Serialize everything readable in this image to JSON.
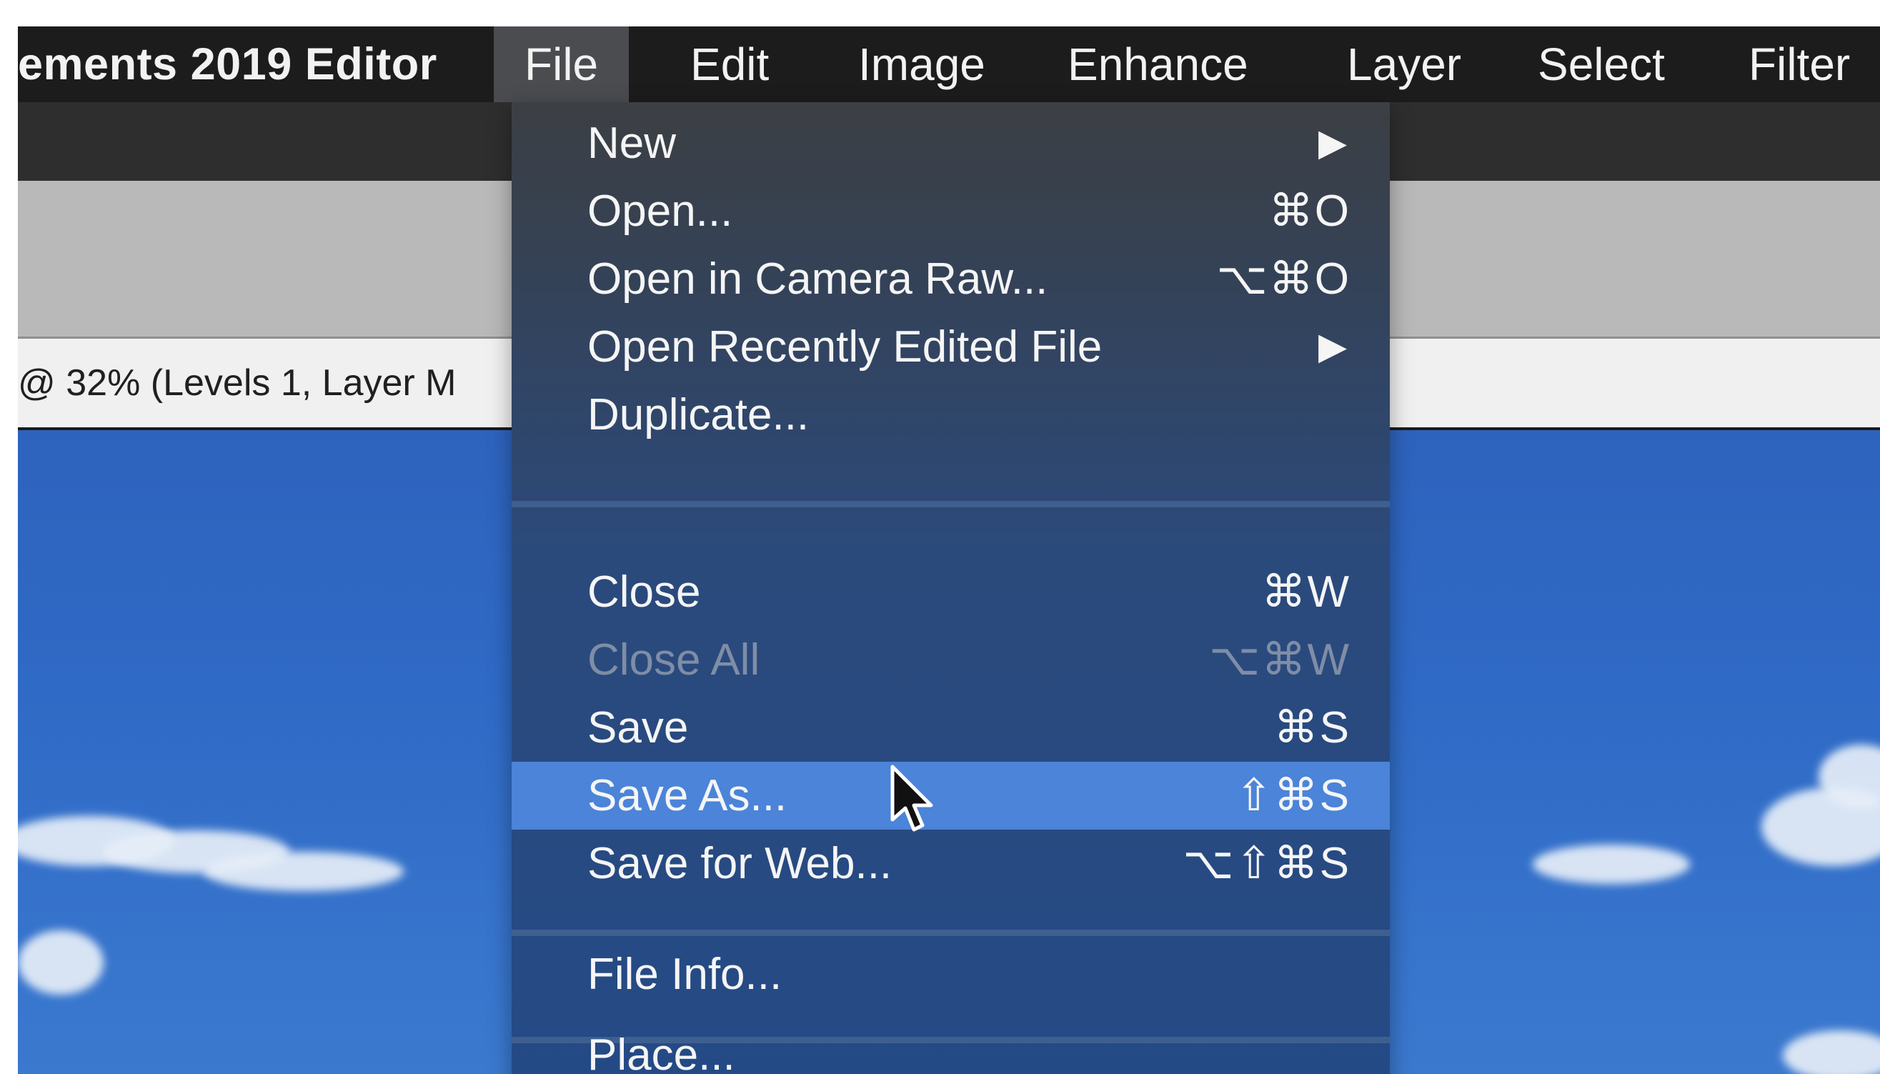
{
  "app": {
    "title": "ements 2019 Editor"
  },
  "menubar": {
    "items": [
      {
        "label": "File"
      },
      {
        "label": "Edit"
      },
      {
        "label": "Image"
      },
      {
        "label": "Enhance"
      },
      {
        "label": "Layer"
      },
      {
        "label": "Select"
      },
      {
        "label": "Filter"
      }
    ]
  },
  "document": {
    "tab_label": "@ 32% (Levels 1, Layer M"
  },
  "file_menu": {
    "items": [
      {
        "label": "New",
        "arrow": "▶"
      },
      {
        "label": "Open...",
        "shortcut": "⌘O"
      },
      {
        "label": "Open in Camera Raw...",
        "shortcut": "⌥⌘O"
      },
      {
        "label": "Open Recently Edited File",
        "arrow": "▶"
      },
      {
        "label": "Duplicate..."
      },
      {
        "label": "Close",
        "shortcut": "⌘W"
      },
      {
        "label": "Close All",
        "shortcut": "⌥⌘W",
        "disabled": true
      },
      {
        "label": "Save",
        "shortcut": "⌘S"
      },
      {
        "label": "Save As...",
        "shortcut": "⇧⌘S",
        "highlighted": true
      },
      {
        "label": "Save for Web...",
        "shortcut": "⌥⇧⌘S"
      },
      {
        "label": "File Info..."
      },
      {
        "label": "Place..."
      }
    ]
  },
  "colors": {
    "menubar": "#1c1c1c",
    "dropdown_top": "#3c3f43",
    "dropdown_bottom": "#244a86",
    "highlight": "#4b84d8",
    "sky": "#2f6ac6"
  }
}
